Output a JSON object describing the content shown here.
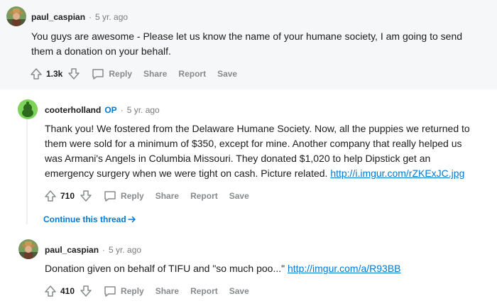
{
  "comments": [
    {
      "user": "paul_caspian",
      "op": "",
      "time": "5 yr. ago",
      "lines": [
        "You guys are awesome - Please let us know the name of your humane society, I am going to send",
        "them a donation on your behalf."
      ],
      "link": "",
      "score": "1.3k"
    },
    {
      "user": "cooterholland",
      "op": "OP",
      "time": "5 yr. ago",
      "lines": [
        "Thank you! We fostered from the Delaware Humane Society. Now, all the puppies we returned to",
        "them were sold for a minimum of $350, except for mine. Another company that really helped us",
        "was Armani's Angels in Columbia Missouri. They donated $1,020 to help Dipstick get an",
        "emergency surgery when we were tight on cash. Picture related. "
      ],
      "link": "http://i.imgur.com/rZKExJC.jpg",
      "score": "710"
    },
    {
      "user": "paul_caspian",
      "op": "",
      "time": "5 yr. ago",
      "lines": [
        "Donation given on behalf of TIFU and \"so much poo...\" "
      ],
      "link": "http://imgur.com/a/R93BB",
      "score": "410"
    }
  ],
  "actions": {
    "reply": "Reply",
    "share": "Share",
    "report": "Report",
    "save": "Save"
  },
  "continue_thread": "Continue this thread",
  "separator": "·",
  "colors": {
    "link": "#0079d3",
    "meta": "#7c7c7c",
    "action": "#878a8c",
    "op": "#0079d3",
    "highlight_bg": "#f6f7f8"
  },
  "icons": [
    "avatar-photo-icon",
    "default-avatar-icon",
    "upvote-icon",
    "downvote-icon",
    "comment-bubble-icon",
    "arrow-right-icon"
  ]
}
